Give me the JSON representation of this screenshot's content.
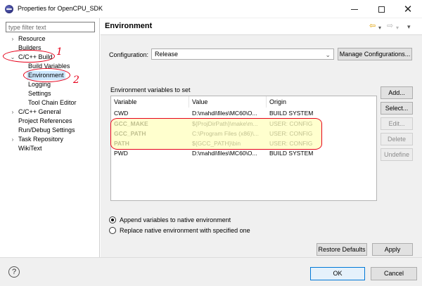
{
  "window": {
    "title": "Properties for OpenCPU_SDK",
    "minimize_icon": "minimize-icon",
    "maximize_icon": "maximize-icon",
    "close_glyph": "✕"
  },
  "sidebar": {
    "filter_placeholder": "type filter text",
    "items": [
      {
        "label": "Resource",
        "expandable": true,
        "expanded": false
      },
      {
        "label": "Builders",
        "expandable": false
      },
      {
        "label": "C/C++ Build",
        "expandable": true,
        "expanded": true
      },
      {
        "label": "Build Variables",
        "expandable": false
      },
      {
        "label": "Environment",
        "expandable": false,
        "selected": true
      },
      {
        "label": "Logging",
        "expandable": false
      },
      {
        "label": "Settings",
        "expandable": false
      },
      {
        "label": "Tool Chain Editor",
        "expandable": false
      },
      {
        "label": "C/C++ General",
        "expandable": true,
        "expanded": false
      },
      {
        "label": "Project References",
        "expandable": false
      },
      {
        "label": "Run/Debug Settings",
        "expandable": false
      },
      {
        "label": "Task Repository",
        "expandable": true,
        "expanded": false
      },
      {
        "label": "WikiText",
        "expandable": false
      }
    ]
  },
  "annotations": {
    "note_1": "1",
    "note_2": "2"
  },
  "header": {
    "title": "Environment",
    "back_glyph": "⇦",
    "forward_glyph": "⇨",
    "menu_glyph": "▾"
  },
  "configuration": {
    "label": "Configuration:",
    "selected": "Release",
    "manage_button": "Manage Configurations..."
  },
  "env_table": {
    "section_label": "Environment variables to set",
    "columns": [
      "Variable",
      "Value",
      "Origin"
    ],
    "rows": [
      {
        "variable": "CWD",
        "value": "D:\\mahdi\\files\\MC60\\O...",
        "origin": "BUILD SYSTEM",
        "user": false
      },
      {
        "variable": "GCC_MAKE",
        "value": "${ProjDirPath}\\make\\m...",
        "origin": "USER: CONFIG",
        "user": true
      },
      {
        "variable": "GCC_PATH",
        "value": "C:\\Program Files (x86)\\...",
        "origin": "USER: CONFIG",
        "user": true
      },
      {
        "variable": "PATH",
        "value": "${GCC_PATH}\\bin",
        "origin": "USER: CONFIG",
        "user": true
      },
      {
        "variable": "PWD",
        "value": "D:\\mahdi\\files\\MC60\\O...",
        "origin": "BUILD SYSTEM",
        "user": false
      }
    ]
  },
  "side_buttons": {
    "add": "Add...",
    "select": "Select...",
    "edit": "Edit...",
    "delete": "Delete",
    "undefine": "Undefine"
  },
  "options": {
    "append_label": "Append variables to native environment",
    "replace_label": "Replace native environment with specified one",
    "append_checked": true
  },
  "page_buttons": {
    "restore_defaults": "Restore Defaults",
    "apply": "Apply"
  },
  "dialog_buttons": {
    "ok": "OK",
    "cancel": "Cancel",
    "help_glyph": "?"
  },
  "colors": {
    "annotation": "#e6001a",
    "highlight": "#ffffbe",
    "selection": "#cde8ff"
  }
}
